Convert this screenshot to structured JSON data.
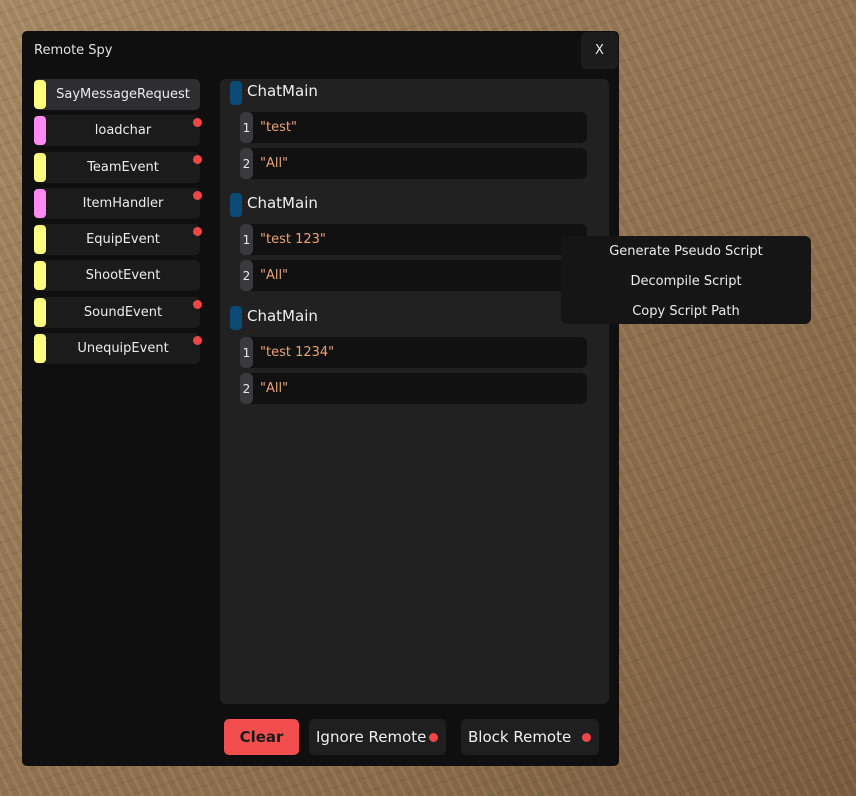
{
  "window": {
    "title": "Remote Spy",
    "close_label": "X"
  },
  "remotes": [
    {
      "name": "SayMessageRequest",
      "color": "#ffff80",
      "selected": true,
      "blocked": false
    },
    {
      "name": "loadchar",
      "color": "#ff8af2",
      "selected": false,
      "blocked": true
    },
    {
      "name": "TeamEvent",
      "color": "#ffff80",
      "selected": false,
      "blocked": true
    },
    {
      "name": "ItemHandler",
      "color": "#ff8af2",
      "selected": false,
      "blocked": true
    },
    {
      "name": "EquipEvent",
      "color": "#ffff80",
      "selected": false,
      "blocked": true
    },
    {
      "name": "ShootEvent",
      "color": "#ffff80",
      "selected": false,
      "blocked": false
    },
    {
      "name": "SoundEvent",
      "color": "#ffff80",
      "selected": false,
      "blocked": true
    },
    {
      "name": "UnequipEvent",
      "color": "#ffff80",
      "selected": false,
      "blocked": true
    }
  ],
  "calls": [
    {
      "script": "ChatMain",
      "args": [
        {
          "index": "1",
          "value": "\"test\""
        },
        {
          "index": "2",
          "value": "\"All\""
        }
      ]
    },
    {
      "script": "ChatMain",
      "args": [
        {
          "index": "1",
          "value": "\"test 123\""
        },
        {
          "index": "2",
          "value": "\"All\""
        }
      ]
    },
    {
      "script": "ChatMain",
      "args": [
        {
          "index": "1",
          "value": "\"test 1234\""
        },
        {
          "index": "2",
          "value": "\"All\""
        }
      ]
    }
  ],
  "buttons": {
    "clear": "Clear",
    "ignore_remote": "Ignore Remote",
    "block_remote": "Block Remote"
  },
  "context_menu": {
    "items": [
      "Generate Pseudo Script",
      "Decompile Script",
      "Copy Script Path"
    ]
  },
  "colors": {
    "accent_red": "#f24e4e",
    "marker_blue": "#0b4a74",
    "arg_string": "#e8a27a"
  }
}
